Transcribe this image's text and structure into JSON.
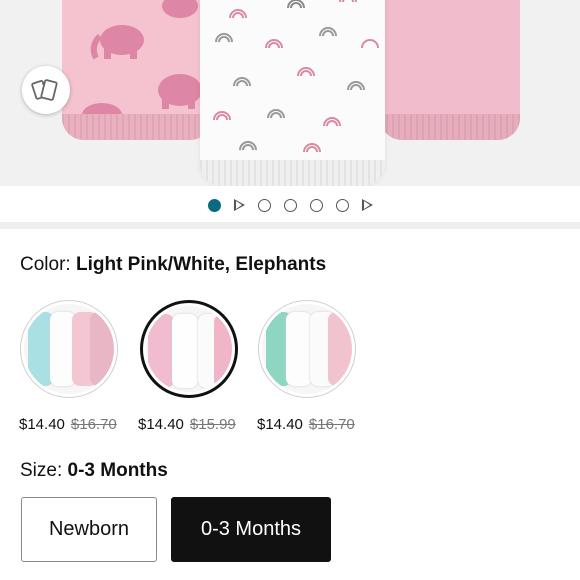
{
  "carousel": {
    "total_images": 6,
    "active_index": 0,
    "video_markers": [
      1,
      6
    ],
    "accent_color": "#0a6a80"
  },
  "view_toggle": {
    "icon": "view-in-room-icon"
  },
  "color": {
    "label": "Color:",
    "selected": "Light Pink/White, Elephants"
  },
  "swatches": [
    {
      "price": "$14.40",
      "list_price": "$16.70",
      "selected": false
    },
    {
      "price": "$14.40",
      "list_price": "$15.99",
      "selected": true
    },
    {
      "price": "$14.40",
      "list_price": "$16.70",
      "selected": false
    }
  ],
  "size": {
    "label": "Size:",
    "selected": "0-3 Months",
    "options": [
      {
        "label": "Newborn",
        "selected": false
      },
      {
        "label": "0-3 Months",
        "selected": true
      }
    ]
  }
}
